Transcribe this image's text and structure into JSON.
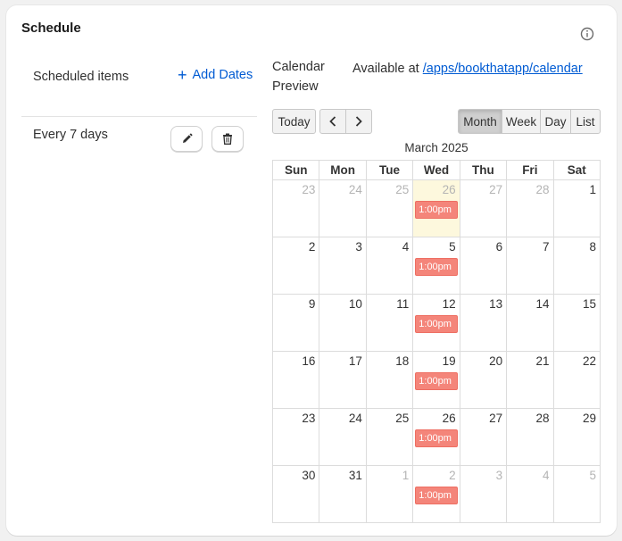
{
  "card": {
    "title": "Schedule"
  },
  "left": {
    "header": "Scheduled items",
    "add_button": "Add Dates",
    "items": [
      {
        "label": "Every 7 days"
      }
    ]
  },
  "calendar": {
    "title": "Calendar Preview",
    "available_prefix": "Available at ",
    "available_link": "/apps/bookthatapp/calendar",
    "today_button": "Today",
    "views": {
      "month": "Month",
      "week": "Week",
      "day": "Day",
      "list": "List"
    },
    "active_view": "Month",
    "month_title": "March 2025",
    "weekdays": [
      "Sun",
      "Mon",
      "Tue",
      "Wed",
      "Thu",
      "Fri",
      "Sat"
    ],
    "weeks": [
      [
        {
          "day": "23",
          "other": true
        },
        {
          "day": "24",
          "other": true
        },
        {
          "day": "25",
          "other": true
        },
        {
          "day": "26",
          "other": true,
          "today": true,
          "event": "1:00pm"
        },
        {
          "day": "27",
          "other": true
        },
        {
          "day": "28",
          "other": true
        },
        {
          "day": "1"
        }
      ],
      [
        {
          "day": "2"
        },
        {
          "day": "3"
        },
        {
          "day": "4"
        },
        {
          "day": "5",
          "event": "1:00pm"
        },
        {
          "day": "6"
        },
        {
          "day": "7"
        },
        {
          "day": "8"
        }
      ],
      [
        {
          "day": "9"
        },
        {
          "day": "10"
        },
        {
          "day": "11"
        },
        {
          "day": "12",
          "event": "1:00pm"
        },
        {
          "day": "13"
        },
        {
          "day": "14"
        },
        {
          "day": "15"
        }
      ],
      [
        {
          "day": "16"
        },
        {
          "day": "17"
        },
        {
          "day": "18"
        },
        {
          "day": "19",
          "event": "1:00pm"
        },
        {
          "day": "20"
        },
        {
          "day": "21"
        },
        {
          "day": "22"
        }
      ],
      [
        {
          "day": "23"
        },
        {
          "day": "24"
        },
        {
          "day": "25"
        },
        {
          "day": "26",
          "event": "1:00pm"
        },
        {
          "day": "27"
        },
        {
          "day": "28"
        },
        {
          "day": "29"
        }
      ],
      [
        {
          "day": "30"
        },
        {
          "day": "31"
        },
        {
          "day": "1",
          "other": true
        },
        {
          "day": "2",
          "other": true,
          "event": "1:00pm"
        },
        {
          "day": "3",
          "other": true
        },
        {
          "day": "4",
          "other": true
        },
        {
          "day": "5",
          "other": true
        }
      ]
    ]
  },
  "colors": {
    "link": "#005bd3",
    "event": "#f4857a",
    "today_bg": "#fdf8dd"
  },
  "icons": {
    "info": "info-circle-icon",
    "add": "plus-icon",
    "edit": "pencil-icon",
    "delete": "trash-icon",
    "prev": "chevron-left-icon",
    "next": "chevron-right-icon"
  }
}
